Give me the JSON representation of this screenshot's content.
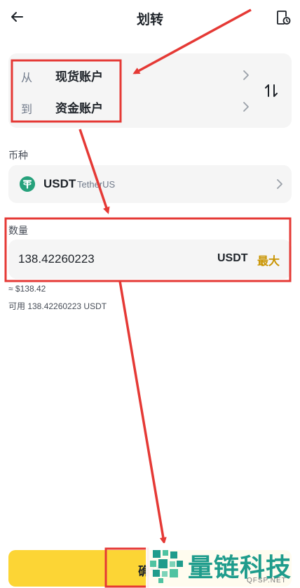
{
  "header": {
    "title": "划转"
  },
  "transfer": {
    "from_prefix": "从",
    "from_account": "现货账户",
    "to_prefix": "到",
    "to_account": "资金账户"
  },
  "coin": {
    "section_label": "币种",
    "symbol": "USDT",
    "name": "TetherUS"
  },
  "amount": {
    "section_label": "数量",
    "value": "138.42260223",
    "unit": "USDT",
    "max_label": "最大",
    "fiat_value": "≈ $138.42",
    "available": "可用 138.42260223 USDT"
  },
  "confirm": {
    "label": "确认"
  },
  "watermark": {
    "text": "量链科技",
    "sub": "QFSP.NET"
  },
  "colors": {
    "accent": "#fcd535",
    "max": "#c99400",
    "annotation": "#e53935",
    "watermark": "#1f9c8c"
  },
  "icons": {
    "back": "arrow-left-icon",
    "history": "history-record-icon",
    "swap": "swap-vertical-icon",
    "chevron": "chevron-right-icon",
    "coin": "tether-logo-icon"
  }
}
